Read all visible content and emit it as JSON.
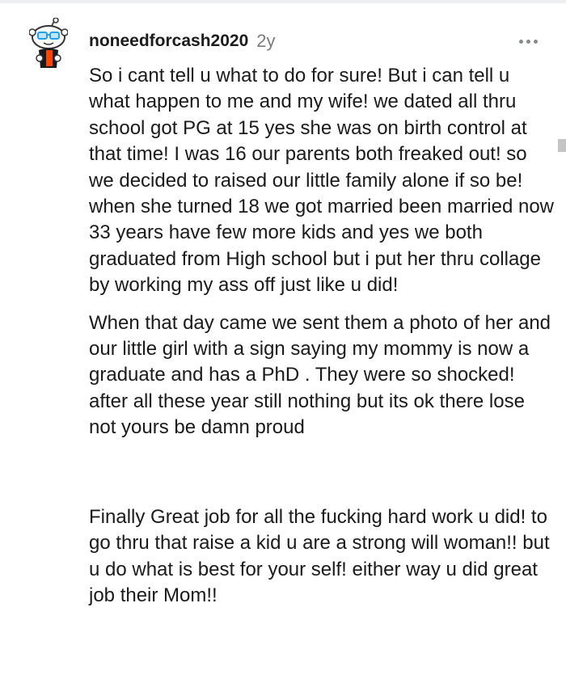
{
  "comment": {
    "username": "noneedforcash2020",
    "age": "2y",
    "more_icon": "more-horizontal-icon",
    "avatar_icon": "snoo-avatar-icon",
    "paragraphs": [
      "So i cant tell u what to do for sure! But i can tell u what happen to me and my wife! we dated all thru school got PG at 15 yes she was on birth control at that time! I was 16 our parents both freaked out! so we decided to raised our little family alone if so be!\nwhen she turned 18 we got married been married now 33 years have few more kids and yes we both graduated from High school but i put her thru collage by working my ass off just like u did!",
      "When that day came we sent them a photo of her and our little girl with a sign saying my mommy is now a graduate and has a PhD . They were so shocked! after all these year still nothing but its ok there lose not yours be damn proud",
      "Finally Great job for all the fucking hard work u did! to go thru that raise a kid u are a strong will woman!! but u do what is best for your self! either way u did great job their Mom!!"
    ]
  },
  "colors": {
    "text": "#1a1a1b",
    "meta": "#7c7c7c",
    "avatar_accent": "#ff4500",
    "glasses": "#24a0ed"
  }
}
